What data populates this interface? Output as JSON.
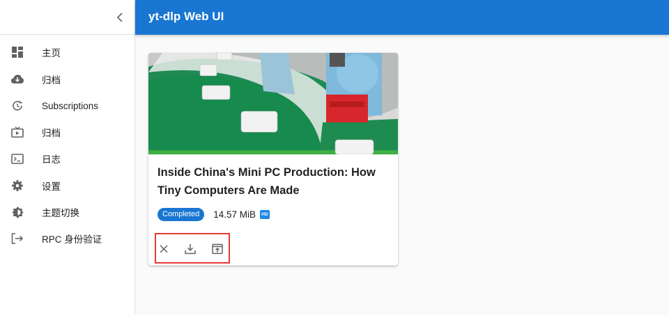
{
  "appbar": {
    "title": "yt-dlp Web UI"
  },
  "sidebar": {
    "collapse_icon": "chevron-left-icon",
    "items": [
      {
        "label": "主页",
        "icon": "dashboard-icon"
      },
      {
        "label": "归档",
        "icon": "cloud-download-icon"
      },
      {
        "label": "Subscriptions",
        "icon": "update-icon"
      },
      {
        "label": "归档",
        "icon": "live-tv-icon"
      },
      {
        "label": "日志",
        "icon": "terminal-icon"
      },
      {
        "label": "设置",
        "icon": "settings-icon"
      },
      {
        "label": "主题切换",
        "icon": "brightness-icon"
      },
      {
        "label": "RPC 身份验证",
        "icon": "logout-icon"
      }
    ]
  },
  "card": {
    "title": "Inside China's Mini PC Production: How Tiny Computers Are Made",
    "status": "Completed",
    "size": "14.57 MiB",
    "quality_badge": "HD",
    "actions": [
      "close-icon",
      "download-icon",
      "open-in-new-tab-icon"
    ]
  },
  "colors": {
    "primary": "#1976d2",
    "highlight": "#e53935"
  }
}
